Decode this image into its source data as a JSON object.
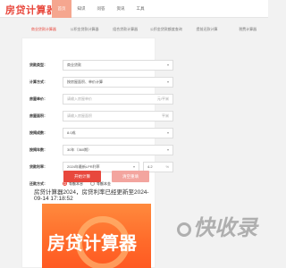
{
  "header": {
    "logo": "房贷计算器",
    "nav": [
      {
        "label": "首页",
        "active": true
      },
      {
        "label": "知识",
        "active": false
      },
      {
        "label": "问答",
        "active": false
      },
      {
        "label": "资讯",
        "active": false
      },
      {
        "label": "工具",
        "active": false
      }
    ]
  },
  "tabs": [
    {
      "label": "商业贷款计算器",
      "active": true
    },
    {
      "label": "公积金贷款计算器",
      "active": false
    },
    {
      "label": "组合贷款计算器",
      "active": false
    },
    {
      "label": "公积金贷款额度查询",
      "active": false
    },
    {
      "label": "提前还款计算",
      "active": false
    },
    {
      "label": "税费计算器",
      "active": false
    }
  ],
  "form": {
    "loan_type": {
      "label": "贷款类型：",
      "value": "商业贷款"
    },
    "calc_method": {
      "label": "计算方式：",
      "value": "按房屋面积、单价计算"
    },
    "price": {
      "label": "房屋单价：",
      "placeholder": "请输入房屋单价",
      "unit": "元/平米"
    },
    "area": {
      "label": "房屋面积：",
      "placeholder": "请输入房屋面积",
      "unit": "平米"
    },
    "ratio": {
      "label": "按揭成数：",
      "value": "8.0成"
    },
    "years": {
      "label": "按揭年数：",
      "value": "30年（360期）"
    },
    "rate": {
      "label": "贷款利率：",
      "value": "2024年最新LPR利率",
      "extra": "4.2"
    },
    "repay": {
      "label": "还款方式：",
      "options": [
        {
          "label": "等额本息",
          "checked": true
        },
        {
          "label": "等额本金",
          "checked": false
        }
      ]
    },
    "buttons": {
      "calculate": "开始计算",
      "reset": "清空重填"
    }
  },
  "article": {
    "title": "房贷计算器2024，房贷利率已经更新至2024-09-14 17:18:52"
  },
  "banner": {
    "text": "房贷计算器"
  },
  "watermark": {
    "text": "快收录"
  }
}
